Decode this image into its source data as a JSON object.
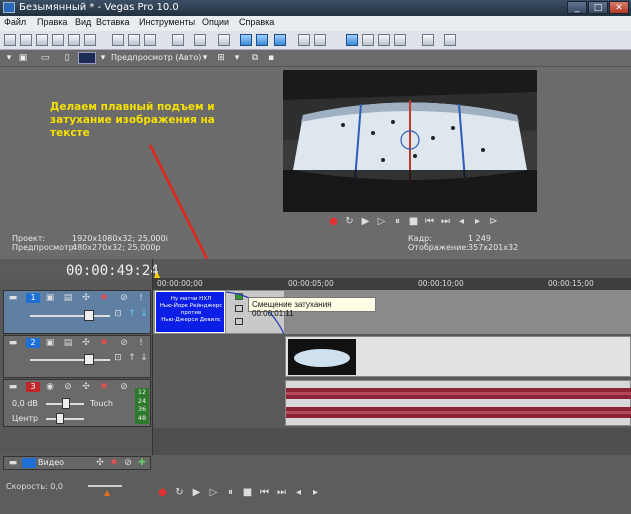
{
  "window": {
    "title": "Безымянный * - Vegas Pro 10.0",
    "min": "_",
    "max": "□",
    "close": "✕"
  },
  "menu": [
    "Файл",
    "Правка",
    "Вид",
    "Вставка",
    "Инструменты",
    "Опции",
    "Справка"
  ],
  "preview": {
    "mode": "Предпросмотр (Авто)",
    "annotation": "Делаем плавный подъем и затухание изображения на тексте",
    "project_label": "Проект:",
    "project_value": "1920x1080x32; 25,000i",
    "preview_label": "Предпросмотр:",
    "preview_value": "480x270x32; 25,000p",
    "frame_label": "Кадр:",
    "frame_value": "1 249",
    "display_label": "Отображение:",
    "display_value": "357x201x32"
  },
  "timeline": {
    "timecode": "00:00:49:24",
    "ruler": [
      "00:00:00;00",
      "00:00:05;00",
      "00:00:10;00",
      "00:00:15;00"
    ],
    "tooltip": "Смещение затухания 00:00:01:11",
    "tracks": [
      {
        "num": "1",
        "color": "#1e6fd6"
      },
      {
        "num": "2",
        "color": "#1e6fd6"
      },
      {
        "num": "3",
        "color": "#c0262a",
        "volume": "0,0 dB",
        "pan": "Центр",
        "mode": "Touch",
        "meter": [
          "12",
          "24",
          "36",
          "48"
        ]
      }
    ],
    "title_clip_lines": [
      "Ну матчи НХЛ",
      "Нью-Йорк Рейнджерс",
      "против",
      "Нью-Джерси Девилс"
    ],
    "bus_label": "Видео",
    "speed_label": "Скорость: 0,0"
  },
  "colors": {
    "accent": "#1e6fd6",
    "annotation": "#f5e000",
    "arrow": "#e3241b"
  }
}
